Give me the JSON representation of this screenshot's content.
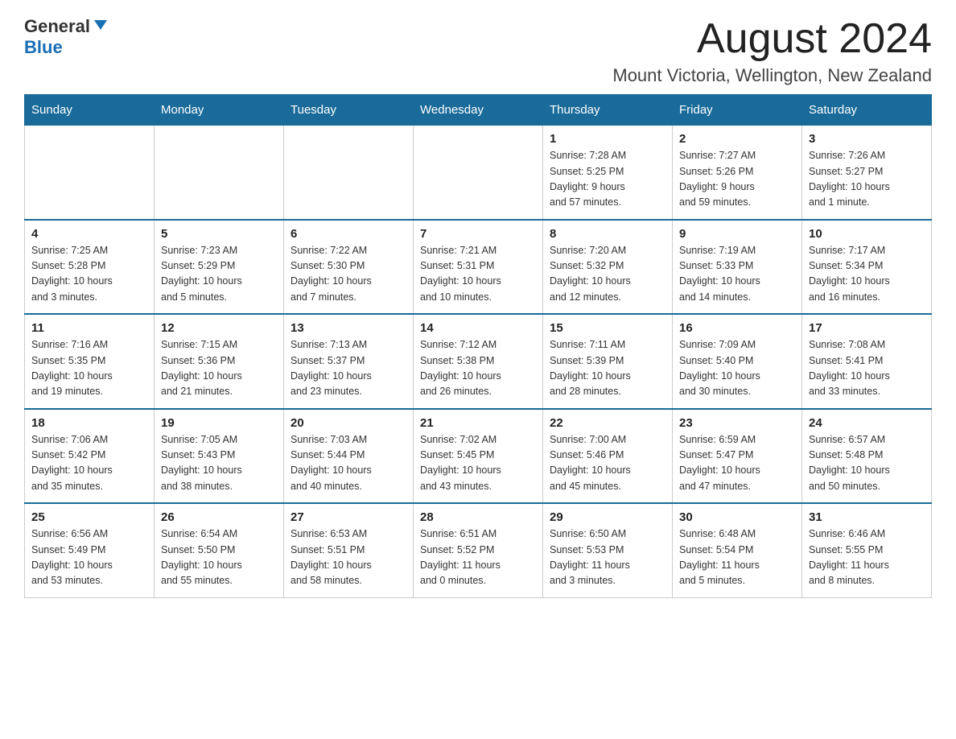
{
  "header": {
    "logo_general": "General",
    "logo_blue": "Blue",
    "month_title": "August 2024",
    "location": "Mount Victoria, Wellington, New Zealand"
  },
  "days_of_week": [
    "Sunday",
    "Monday",
    "Tuesday",
    "Wednesday",
    "Thursday",
    "Friday",
    "Saturday"
  ],
  "weeks": [
    [
      {
        "day": "",
        "info": ""
      },
      {
        "day": "",
        "info": ""
      },
      {
        "day": "",
        "info": ""
      },
      {
        "day": "",
        "info": ""
      },
      {
        "day": "1",
        "info": "Sunrise: 7:28 AM\nSunset: 5:25 PM\nDaylight: 9 hours\nand 57 minutes."
      },
      {
        "day": "2",
        "info": "Sunrise: 7:27 AM\nSunset: 5:26 PM\nDaylight: 9 hours\nand 59 minutes."
      },
      {
        "day": "3",
        "info": "Sunrise: 7:26 AM\nSunset: 5:27 PM\nDaylight: 10 hours\nand 1 minute."
      }
    ],
    [
      {
        "day": "4",
        "info": "Sunrise: 7:25 AM\nSunset: 5:28 PM\nDaylight: 10 hours\nand 3 minutes."
      },
      {
        "day": "5",
        "info": "Sunrise: 7:23 AM\nSunset: 5:29 PM\nDaylight: 10 hours\nand 5 minutes."
      },
      {
        "day": "6",
        "info": "Sunrise: 7:22 AM\nSunset: 5:30 PM\nDaylight: 10 hours\nand 7 minutes."
      },
      {
        "day": "7",
        "info": "Sunrise: 7:21 AM\nSunset: 5:31 PM\nDaylight: 10 hours\nand 10 minutes."
      },
      {
        "day": "8",
        "info": "Sunrise: 7:20 AM\nSunset: 5:32 PM\nDaylight: 10 hours\nand 12 minutes."
      },
      {
        "day": "9",
        "info": "Sunrise: 7:19 AM\nSunset: 5:33 PM\nDaylight: 10 hours\nand 14 minutes."
      },
      {
        "day": "10",
        "info": "Sunrise: 7:17 AM\nSunset: 5:34 PM\nDaylight: 10 hours\nand 16 minutes."
      }
    ],
    [
      {
        "day": "11",
        "info": "Sunrise: 7:16 AM\nSunset: 5:35 PM\nDaylight: 10 hours\nand 19 minutes."
      },
      {
        "day": "12",
        "info": "Sunrise: 7:15 AM\nSunset: 5:36 PM\nDaylight: 10 hours\nand 21 minutes."
      },
      {
        "day": "13",
        "info": "Sunrise: 7:13 AM\nSunset: 5:37 PM\nDaylight: 10 hours\nand 23 minutes."
      },
      {
        "day": "14",
        "info": "Sunrise: 7:12 AM\nSunset: 5:38 PM\nDaylight: 10 hours\nand 26 minutes."
      },
      {
        "day": "15",
        "info": "Sunrise: 7:11 AM\nSunset: 5:39 PM\nDaylight: 10 hours\nand 28 minutes."
      },
      {
        "day": "16",
        "info": "Sunrise: 7:09 AM\nSunset: 5:40 PM\nDaylight: 10 hours\nand 30 minutes."
      },
      {
        "day": "17",
        "info": "Sunrise: 7:08 AM\nSunset: 5:41 PM\nDaylight: 10 hours\nand 33 minutes."
      }
    ],
    [
      {
        "day": "18",
        "info": "Sunrise: 7:06 AM\nSunset: 5:42 PM\nDaylight: 10 hours\nand 35 minutes."
      },
      {
        "day": "19",
        "info": "Sunrise: 7:05 AM\nSunset: 5:43 PM\nDaylight: 10 hours\nand 38 minutes."
      },
      {
        "day": "20",
        "info": "Sunrise: 7:03 AM\nSunset: 5:44 PM\nDaylight: 10 hours\nand 40 minutes."
      },
      {
        "day": "21",
        "info": "Sunrise: 7:02 AM\nSunset: 5:45 PM\nDaylight: 10 hours\nand 43 minutes."
      },
      {
        "day": "22",
        "info": "Sunrise: 7:00 AM\nSunset: 5:46 PM\nDaylight: 10 hours\nand 45 minutes."
      },
      {
        "day": "23",
        "info": "Sunrise: 6:59 AM\nSunset: 5:47 PM\nDaylight: 10 hours\nand 47 minutes."
      },
      {
        "day": "24",
        "info": "Sunrise: 6:57 AM\nSunset: 5:48 PM\nDaylight: 10 hours\nand 50 minutes."
      }
    ],
    [
      {
        "day": "25",
        "info": "Sunrise: 6:56 AM\nSunset: 5:49 PM\nDaylight: 10 hours\nand 53 minutes."
      },
      {
        "day": "26",
        "info": "Sunrise: 6:54 AM\nSunset: 5:50 PM\nDaylight: 10 hours\nand 55 minutes."
      },
      {
        "day": "27",
        "info": "Sunrise: 6:53 AM\nSunset: 5:51 PM\nDaylight: 10 hours\nand 58 minutes."
      },
      {
        "day": "28",
        "info": "Sunrise: 6:51 AM\nSunset: 5:52 PM\nDaylight: 11 hours\nand 0 minutes."
      },
      {
        "day": "29",
        "info": "Sunrise: 6:50 AM\nSunset: 5:53 PM\nDaylight: 11 hours\nand 3 minutes."
      },
      {
        "day": "30",
        "info": "Sunrise: 6:48 AM\nSunset: 5:54 PM\nDaylight: 11 hours\nand 5 minutes."
      },
      {
        "day": "31",
        "info": "Sunrise: 6:46 AM\nSunset: 5:55 PM\nDaylight: 11 hours\nand 8 minutes."
      }
    ]
  ]
}
